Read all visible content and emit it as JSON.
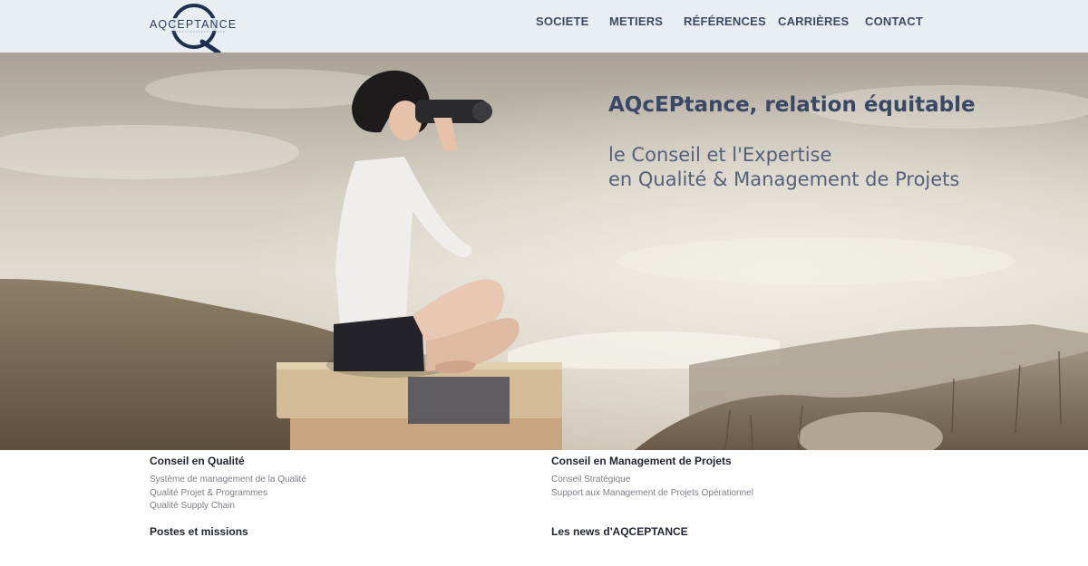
{
  "brand": {
    "logo_text": "AQCEPTANCE"
  },
  "nav": {
    "items": [
      {
        "label": "SOCIETE"
      },
      {
        "label": "METIERS"
      },
      {
        "label": "RÉFÉRENCES"
      },
      {
        "label": "CARRIÈRES"
      },
      {
        "label": "CONTACT"
      }
    ]
  },
  "hero": {
    "title": "AQcEPtance, relation équitable",
    "subtitle_line1": "le Conseil et l'Expertise",
    "subtitle_line2": "en Qualité & Management de Projets"
  },
  "sections": {
    "quality": {
      "title": "Conseil en Qualité",
      "links": [
        "Système de management de la Qualité",
        "Qualité Projet & Programmes",
        "Qualité Supply Chain"
      ]
    },
    "project": {
      "title": "Conseil en Management de Projets",
      "links": [
        "Conseil Stratégique",
        "Support aux Management de Projets Opérationnel"
      ]
    },
    "jobs": {
      "title": "Postes et missions"
    },
    "news": {
      "title": "Les news d'AQCEPTANCE"
    }
  },
  "colors": {
    "header_bg": "#e8eef2",
    "nav_text": "#3d4a63",
    "logo_navy": "#1f2f4f",
    "hero_title": "#3a4866",
    "hero_subtitle": "#55617a",
    "link_gray": "#7c7f86"
  }
}
